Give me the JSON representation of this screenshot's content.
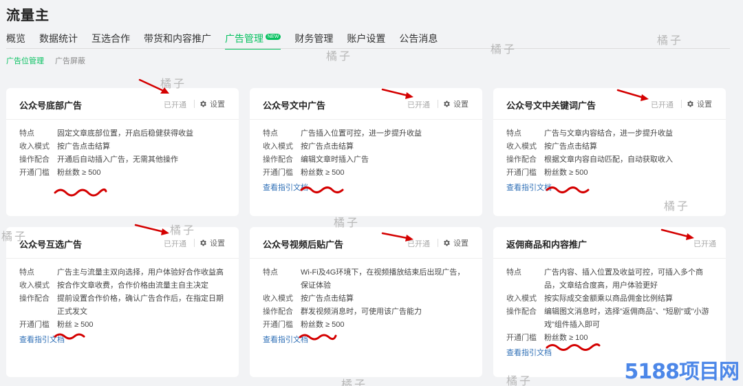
{
  "app": {
    "title": "流量主"
  },
  "nav": {
    "items": [
      {
        "label": "概览"
      },
      {
        "label": "数据统计"
      },
      {
        "label": "互选合作"
      },
      {
        "label": "带货和内容推广"
      },
      {
        "label": "广告管理",
        "badge": "NEW"
      },
      {
        "label": "财务管理"
      },
      {
        "label": "账户设置"
      },
      {
        "label": "公告消息"
      }
    ]
  },
  "subnav": {
    "items": [
      {
        "label": "广告位管理"
      },
      {
        "label": "广告屏蔽"
      }
    ]
  },
  "colors": {
    "accent": "#07c160",
    "link": "#2f6fb6",
    "annotation": "#d40000"
  },
  "cards": [
    {
      "title": "公众号底部广告",
      "status": "已开通",
      "settings": "设置",
      "rows": [
        {
          "label": "特点",
          "value": "固定文章底部位置，开启后稳健获得收益"
        },
        {
          "label": "收入模式",
          "value": "按广告点击结算"
        },
        {
          "label": "操作配合",
          "value": "开通后自动插入广告，无需其他操作"
        },
        {
          "label": "开通门槛",
          "value": "粉丝数 ≥ 500"
        }
      ]
    },
    {
      "title": "公众号文中广告",
      "status": "已开通",
      "settings": "设置",
      "rows": [
        {
          "label": "特点",
          "value": "广告插入位置可控，进一步提升收益"
        },
        {
          "label": "收入模式",
          "value": "按广告点击结算"
        },
        {
          "label": "操作配合",
          "value": "编辑文章时插入广告"
        },
        {
          "label": "开通门槛",
          "value": "粉丝数 ≥ 500"
        }
      ],
      "link": "查看指引文档"
    },
    {
      "title": "公众号文中关键词广告",
      "status": "已开通",
      "settings": "设置",
      "rows": [
        {
          "label": "特点",
          "value": "广告与文章内容结合，进一步提升收益"
        },
        {
          "label": "收入模式",
          "value": "按广告点击结算"
        },
        {
          "label": "操作配合",
          "value": "根据文章内容自动匹配，自动获取收入"
        },
        {
          "label": "开通门槛",
          "value": "粉丝数 ≥ 500"
        }
      ],
      "link": "查看指引文档"
    },
    {
      "title": "公众号互选广告",
      "status": "已开通",
      "settings": "设置",
      "rows": [
        {
          "label": "特点",
          "value": "广告主与流量主双向选择，用户体验好合作收益高"
        },
        {
          "label": "收入模式",
          "value": "按合作文章收费，合作价格由流量主自主决定"
        },
        {
          "label": "操作配合",
          "value": "提前设置合作价格，确认广告合作后，在指定日期正式发文"
        },
        {
          "label": "开通门槛",
          "value": "粉丝 ≥ 500"
        }
      ],
      "link": "查看指引文档"
    },
    {
      "title": "公众号视频后贴广告",
      "status": "已开通",
      "settings": "设置",
      "rows": [
        {
          "label": "特点",
          "value": "Wi-Fi及4G环境下，在视频播放结束后出现广告，保证体验"
        },
        {
          "label": "收入模式",
          "value": "按广告点击结算"
        },
        {
          "label": "操作配合",
          "value": "群发视频消息时，可使用该广告能力"
        },
        {
          "label": "开通门槛",
          "value": "粉丝数 ≥ 500"
        }
      ],
      "link": "查看指引文档"
    },
    {
      "title": "返佣商品和内容推广",
      "status": "已开通",
      "rows": [
        {
          "label": "特点",
          "value": "广告内容、插入位置及收益可控，可插入多个商品，文章结合度高，用户体验更好"
        },
        {
          "label": "收入模式",
          "value": "按实际成交金额乘以商品佣金比例结算"
        },
        {
          "label": "操作配合",
          "value": "编辑图文消息时，选择\"返佣商品\"、\"短剧\"或\"小游戏\"组件插入即可"
        },
        {
          "label": "开通门槛",
          "value": "粉丝数 ≥ 100"
        }
      ],
      "link": "查看指引文档"
    }
  ],
  "watermarks": [
    "橘子",
    "橘子",
    "橘子",
    "橘子",
    "橘子",
    "橘子",
    "橘子",
    "橘子",
    "橘子",
    "橘子"
  ],
  "logo": "5188项目网"
}
